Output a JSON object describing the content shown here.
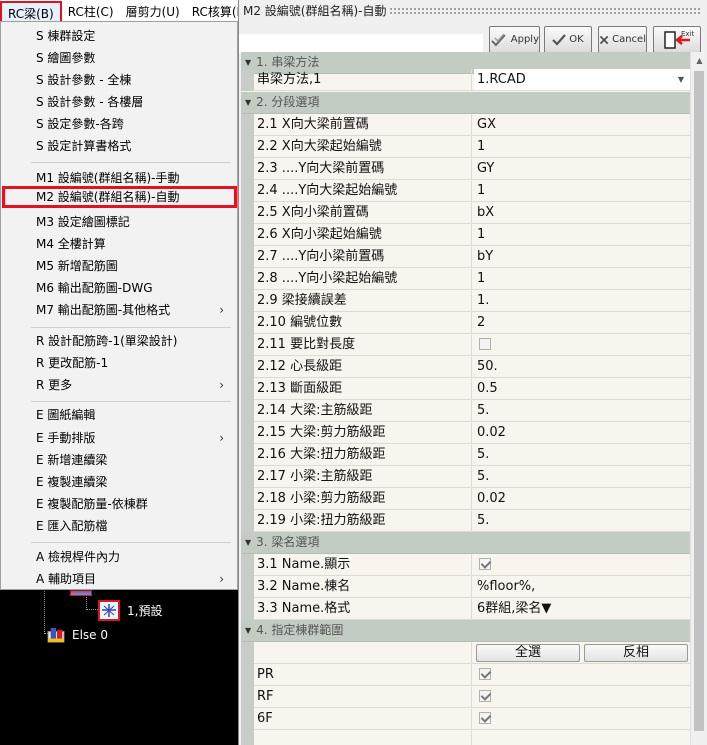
{
  "menubar": {
    "items": [
      {
        "label": "RC梁(B)"
      },
      {
        "label": "RC柱(C)"
      },
      {
        "label": "層剪力(U)"
      },
      {
        "label": "RC核算(K"
      }
    ]
  },
  "menu": {
    "items": [
      {
        "label": "S 棟群設定"
      },
      {
        "label": "S 繪圖參數"
      },
      {
        "label": "S 設計參數 - 全棟"
      },
      {
        "label": "S 設計參數 - 各樓層"
      },
      {
        "label": "S 設定參數-各跨"
      },
      {
        "label": "S 設定計算書格式"
      },
      {
        "label": "M1 設編號(群組名稱)-手動"
      },
      {
        "label": "M2 設編號(群組名稱)-自動"
      },
      {
        "label": "M3 設定繪圖標記"
      },
      {
        "label": "M4 全樓計算"
      },
      {
        "label": "M5 新增配筋圖"
      },
      {
        "label": "M6 輸出配筋圖-DWG"
      },
      {
        "label": "M7 輸出配筋圖-其他格式"
      },
      {
        "label": "R 設計配筋跨-1(單梁設計)"
      },
      {
        "label": "R 更改配筋-1"
      },
      {
        "label": "R 更多"
      },
      {
        "label": "E 圖紙編輯"
      },
      {
        "label": "E 手動排版"
      },
      {
        "label": "E 新增連續梁"
      },
      {
        "label": "E 複製連續梁"
      },
      {
        "label": "E 複製配筋量-依棟群"
      },
      {
        "label": "E 匯入配筋檔"
      },
      {
        "label": "A 檢視桿件內力"
      },
      {
        "label": "A 輔助項目"
      }
    ],
    "submenu_arrow": "›"
  },
  "tree": {
    "nodes": [
      {
        "label": "1,預設",
        "icon": "beam-group-icon"
      },
      {
        "label": "Else 0",
        "icon": "building-icon"
      }
    ]
  },
  "dialog": {
    "title": "M2 設編號(群組名稱)-自動",
    "buttons": {
      "apply": "Apply",
      "ok": "OK",
      "cancel": "Cancel",
      "exit": "Exit"
    }
  },
  "grid": {
    "sec1": {
      "label": "1. 串梁方法"
    },
    "sec2": {
      "label": "2. 分段選項"
    },
    "sec3": {
      "label": "3. 梁名選項"
    },
    "sec4": {
      "label": "4. 指定棟群範圍"
    },
    "r_method": {
      "name": "串梁方法,1",
      "value": "1.RCAD"
    },
    "r21": {
      "name": "2.1 X向大梁前置碼",
      "value": "GX"
    },
    "r22": {
      "name": "2.2 X向大梁起始編號",
      "value": "1"
    },
    "r23": {
      "name": "2.3 ....Y向大梁前置碼",
      "value": "GY"
    },
    "r24": {
      "name": "2.4 ....Y向大梁起始編號",
      "value": "1"
    },
    "r25": {
      "name": "2.5 X向小梁前置碼",
      "value": "bX"
    },
    "r26": {
      "name": "2.6 X向小梁起始編號",
      "value": "1"
    },
    "r27": {
      "name": "2.7 ....Y向小梁前置碼",
      "value": "bY"
    },
    "r28": {
      "name": "2.8 ....Y向小梁起始編號",
      "value": "1"
    },
    "r29": {
      "name": "2.9 梁接續誤差",
      "value": "1."
    },
    "r210": {
      "name": "2.10 編號位數",
      "value": "2"
    },
    "r211": {
      "name": "2.11 要比對長度",
      "checked": false
    },
    "r212": {
      "name": "2.12 心長級距",
      "value": "50."
    },
    "r213": {
      "name": "2.13 斷面級距",
      "value": "0.5"
    },
    "r214": {
      "name": "2.14 大梁:主筋級距",
      "value": "5."
    },
    "r215": {
      "name": "2.15 大梁:剪力筋級距",
      "value": "0.02"
    },
    "r216": {
      "name": "2.16 大梁:扭力筋級距",
      "value": "5."
    },
    "r217": {
      "name": "2.17 小梁:主筋級距",
      "value": "5."
    },
    "r218": {
      "name": "2.18 小梁:剪力筋級距",
      "value": "0.02"
    },
    "r219": {
      "name": "2.19 小梁:扭力筋級距",
      "value": "5."
    },
    "r31": {
      "name": "3.1 Name.顯示",
      "checked": true
    },
    "r32": {
      "name": "3.2 Name.棟名",
      "value": "%floor%,"
    },
    "r33": {
      "name": "3.3 Name.格式",
      "value": "6群組,梁名"
    },
    "select_all": "全選",
    "invert": "反相",
    "floors": [
      {
        "name": "PR",
        "checked": true
      },
      {
        "name": "RF",
        "checked": true
      },
      {
        "name": "6F",
        "checked": true
      }
    ]
  },
  "colors": {
    "highlight_border": "#e0141e",
    "category_bg": "#c3ccc3",
    "grid_bg": "#f7f5ed"
  }
}
